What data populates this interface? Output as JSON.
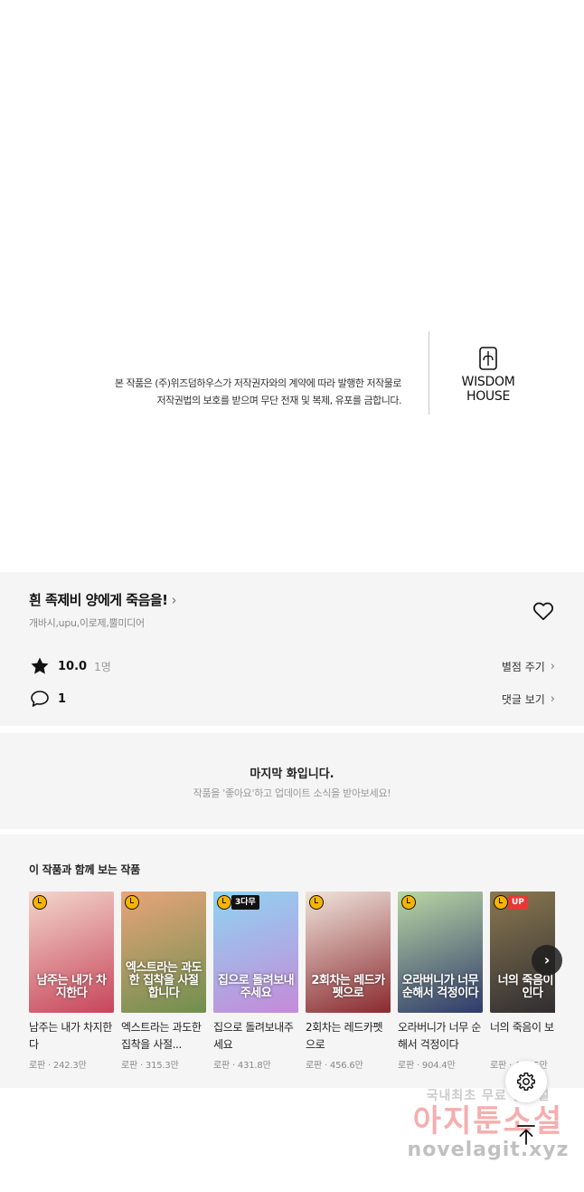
{
  "copyright": {
    "line1": "본 작품은 (주)위즈덤하우스가 저작권자와의 계약에 따라 발행한 저작물로",
    "line2": "저작권법의 보호를 받으며 무단 전재 및 복제, 유포를 금합니다.",
    "publisher_line1": "WISDOM",
    "publisher_line2": "HOUSE"
  },
  "series": {
    "title": "흰 족제비 양에게 죽음을!",
    "creators": "개바시,upu,이로제,뿔미디어",
    "rating_value": "10.0",
    "rating_count": "1명",
    "rate_link": "별점 주기",
    "comment_count": "1",
    "comment_link": "댓글 보기"
  },
  "last_episode": {
    "title": "마지막 화입니다.",
    "subtitle": "작품을 '좋아요'하고 업데이트 소식을 받아보세요!"
  },
  "recommendations": {
    "heading": "이 작품과 함께 보는 작품",
    "items": [
      {
        "title": "남주는 내가 차지한다",
        "meta": "로판 · 242.3만",
        "badge": "clock",
        "tag": "",
        "cover_text": "남주는 내가 차지한다",
        "color_a": "#c7455a",
        "color_b": "#f3d6cc"
      },
      {
        "title": "엑스트라는 과도한 집착을 사절...",
        "meta": "로판 · 315.3만",
        "badge": "clock",
        "tag": "",
        "cover_text": "엑스트라는 과도한 집착을 사절합니다",
        "color_a": "#6f8f4e",
        "color_b": "#e8a47a"
      },
      {
        "title": "집으로 돌려보내주세요",
        "meta": "로판 · 431.8만",
        "badge": "clock",
        "tag": "3다무",
        "cover_text": "집으로 돌려보내주세요",
        "color_a": "#c58ad8",
        "color_b": "#8fd4f2"
      },
      {
        "title": "2회차는 레드카펫으로",
        "meta": "로판 · 456.6만",
        "badge": "clock",
        "tag": "",
        "cover_text": "2회차는 레드카펫으로",
        "color_a": "#8a2a2f",
        "color_b": "#f0e4dc"
      },
      {
        "title": "오라버니가 너무 순해서 걱정이다",
        "meta": "로판 · 904.4만",
        "badge": "clock",
        "tag": "",
        "cover_text": "오라버니가 너무 순해서 걱정이다",
        "color_a": "#2f3a6a",
        "color_b": "#b9d7a5"
      },
      {
        "title": "너의 죽음이 보",
        "meta": "로판 · 440.5만",
        "badge": "clock",
        "tag": "UP",
        "cover_text": "너의 죽음이 보인다",
        "color_a": "#2b2a30",
        "color_b": "#8a7850"
      }
    ]
  },
  "watermark": {
    "line1": "국내최초 무료 웹소설",
    "line2": "아지툰소설",
    "line3": "novelagit.xyz"
  },
  "icons": {
    "heart": "heart-icon",
    "star": "star-icon",
    "comment": "comment-bubble-icon",
    "settings": "gear-icon",
    "scroll_top": "arrow-up-to-top-icon",
    "next": "chevron-right-icon"
  }
}
